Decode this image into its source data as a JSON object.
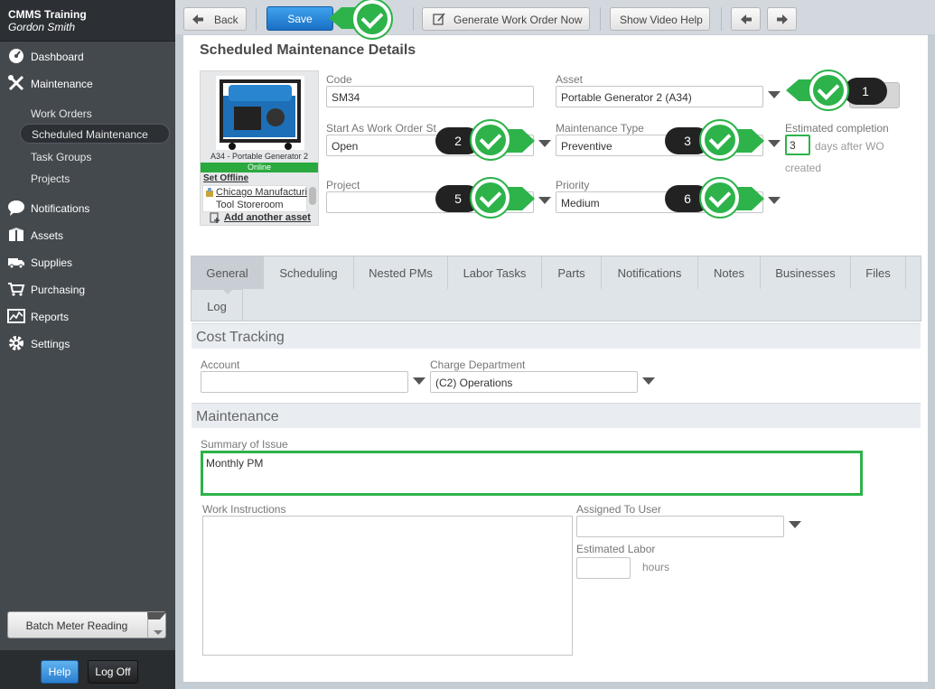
{
  "sidebar": {
    "app_title": "CMMS Training",
    "user_name": "Gordon Smith",
    "nav": {
      "dashboard": "Dashboard",
      "maintenance": "Maintenance",
      "notifications": "Notifications",
      "assets": "Assets",
      "supplies": "Supplies",
      "purchasing": "Purchasing",
      "reports": "Reports",
      "settings": "Settings"
    },
    "sub": {
      "work_orders": "Work Orders",
      "scheduled_maintenance": "Scheduled Maintenance",
      "task_groups": "Task Groups",
      "projects": "Projects"
    },
    "batch_meter": "Batch Meter Reading",
    "help": "Help",
    "logoff": "Log Off"
  },
  "toolbar": {
    "back": "Back",
    "save": "Save",
    "generate": "Generate Work Order Now",
    "video_help": "Show Video Help"
  },
  "page": {
    "title": "Scheduled Maintenance Details"
  },
  "asset_panel": {
    "caption": "A34 - Portable Generator 2",
    "status": "Online",
    "set_offline": "Set Offline",
    "location1": "Chicago Manufacturi",
    "location2": "Tool Storeroom",
    "add_asset": "Add another asset"
  },
  "form": {
    "code_label": "Code",
    "code_value": "SM34",
    "asset_label": "Asset",
    "asset_value": "Portable Generator 2 (A34)",
    "start_label": "Start As Work Order St",
    "start_value": "Open",
    "mtype_label": "Maintenance Type",
    "mtype_value": "Preventive",
    "est_label": "Estimated completion",
    "est_value": "3",
    "est_suffix": "days after WO",
    "est_suffix2": "created",
    "project_label": "Project",
    "project_value": "",
    "priority_label": "Priority",
    "priority_value": "Medium"
  },
  "callouts": [
    "1",
    "2",
    "3",
    "5",
    "6"
  ],
  "tabs": [
    "General",
    "Scheduling",
    "Nested PMs",
    "Labor Tasks",
    "Parts",
    "Notifications",
    "Notes",
    "Businesses",
    "Files",
    "Log"
  ],
  "cost_tracking": {
    "header": "Cost Tracking",
    "account_label": "Account",
    "account_value": "",
    "charge_label": "Charge Department",
    "charge_value": "(C2) Operations"
  },
  "maintenance": {
    "header": "Maintenance",
    "summary_label": "Summary of Issue",
    "summary_value": "Monthly PM",
    "instructions_label": "Work Instructions",
    "assigned_label": "Assigned To User",
    "assigned_value": "",
    "labor_label": "Estimated Labor",
    "labor_value": "",
    "hours": "hours"
  },
  "colors": {
    "accent_blue": "#1a6fc4",
    "highlight_green": "#2db34a",
    "sidebar_bg": "#44494e"
  }
}
